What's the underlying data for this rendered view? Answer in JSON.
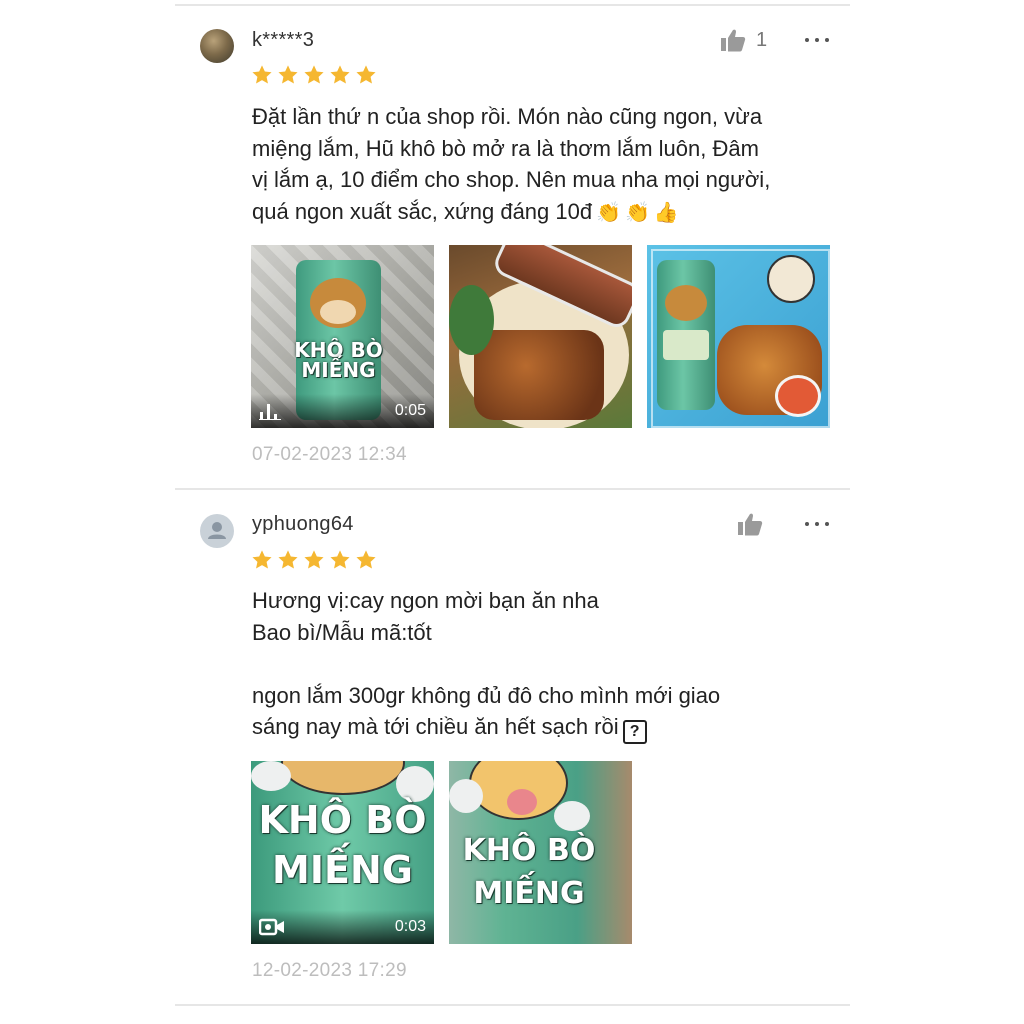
{
  "reviews": [
    {
      "username": "k*****3",
      "like_count": "1",
      "rating": 5,
      "text_lines": [
        "Đặt lần thứ n của shop rồi. Món nào cũng ngon, vừa",
        "miệng lắm, Hũ khô bò mở ra là thơm lắm luôn, Đâm",
        "vị lắm ạ, 10 điểm cho shop. Nên mua nha mọi người,",
        "quá ngon xuất sắc, xứng đáng 10đ"
      ],
      "emojis": [
        "clapping-hands",
        "clapping-hands",
        "thumbs-up"
      ],
      "media": [
        {
          "type": "video",
          "duration": "0:05",
          "label": "KHÔ BÒ MIẾNG"
        },
        {
          "type": "image"
        },
        {
          "type": "image"
        }
      ],
      "timestamp": "07-02-2023 12:34"
    },
    {
      "username": "yphuong64",
      "like_count": "",
      "rating": 5,
      "text_lines": [
        "Hương vị:cay ngon mời bạn ăn nha",
        "Bao bì/Mẫu mã:tốt",
        "",
        "ngon lắm 300gr không đủ đô cho mình mới giao",
        "sáng nay mà tới chiều ăn hết sạch rồi"
      ],
      "unknown_glyph": "?",
      "media": [
        {
          "type": "video",
          "duration": "0:03",
          "label_line1": "KHÔ BÒ",
          "label_line2": "MIẾNG"
        },
        {
          "type": "image",
          "label_line1": "KHÔ BÒ",
          "label_line2": "MIẾNG"
        }
      ],
      "timestamp": "12-02-2023 17:29"
    }
  ],
  "colors": {
    "star": "#f5b731",
    "timestamp": "#bdbdbd",
    "divider": "#e6e6e6",
    "like_icon": "#9a9a9a"
  },
  "icons": {
    "like": "thumbs-up-icon",
    "more": "more-dots-icon",
    "video": "video-camera-icon",
    "audio": "audio-bars-icon"
  }
}
